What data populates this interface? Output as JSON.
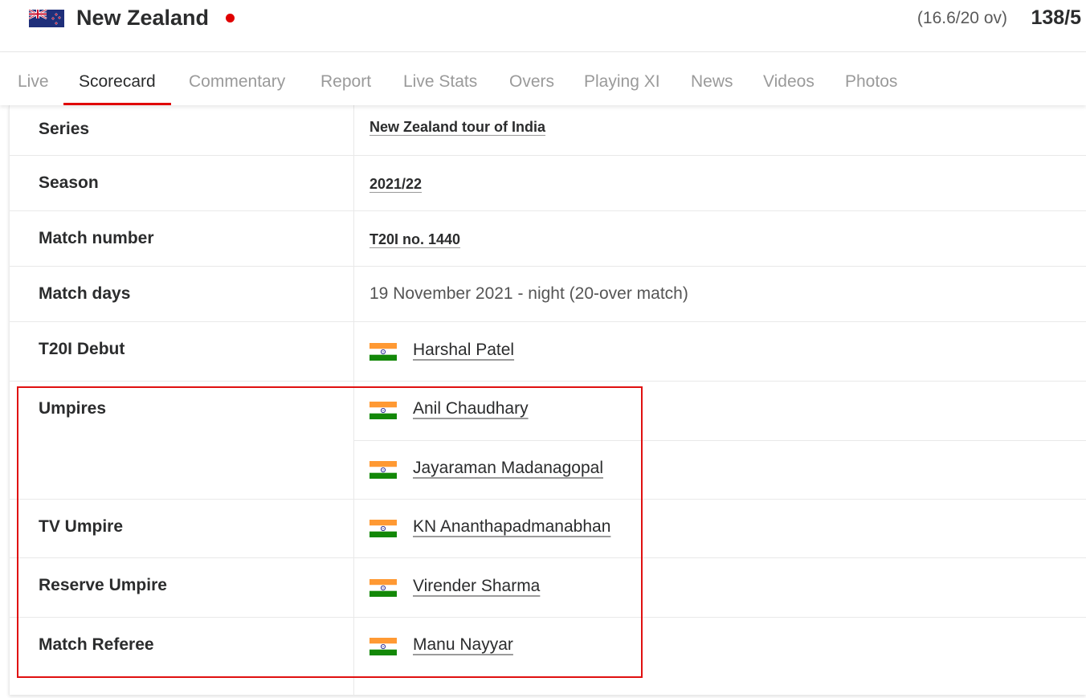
{
  "header": {
    "team_name": "New Zealand",
    "overs": "(16.6/20 ov)",
    "score": "138/5",
    "live_indicator_color": "#e00000"
  },
  "tabs": [
    {
      "label": "Live",
      "active": false
    },
    {
      "label": "Scorecard",
      "active": true
    },
    {
      "label": "Commentary",
      "active": false
    },
    {
      "label": "Report",
      "active": false
    },
    {
      "label": "Live Stats",
      "active": false
    },
    {
      "label": "Overs",
      "active": false
    },
    {
      "label": "Playing XI",
      "active": false
    },
    {
      "label": "News",
      "active": false
    },
    {
      "label": "Videos",
      "active": false
    },
    {
      "label": "Photos",
      "active": false
    }
  ],
  "details": {
    "series": {
      "label": "Series",
      "value": "New Zealand tour of India"
    },
    "season": {
      "label": "Season",
      "value": "2021/22"
    },
    "match_number": {
      "label": "Match number",
      "value": "T20I no. 1440"
    },
    "match_days": {
      "label": "Match days",
      "value": "19 November 2021 - night (20-over match)"
    },
    "debut": {
      "label": "T20I Debut",
      "people": [
        "Harshal Patel"
      ]
    },
    "umpires": {
      "label": "Umpires",
      "people": [
        "Anil Chaudhary",
        "Jayaraman Madanagopal"
      ]
    },
    "tv_umpire": {
      "label": "TV Umpire",
      "people": [
        "KN Ananthapadmanabhan"
      ]
    },
    "reserve_umpire": {
      "label": "Reserve Umpire",
      "people": [
        "Virender Sharma"
      ]
    },
    "match_referee": {
      "label": "Match Referee",
      "people": [
        "Manu Nayyar"
      ]
    }
  },
  "colors": {
    "accent": "#e00000",
    "highlight_box": "#e01010"
  },
  "icons": {
    "team_flag": "new-zealand-flag-icon",
    "person_flag": "india-flag-icon"
  }
}
